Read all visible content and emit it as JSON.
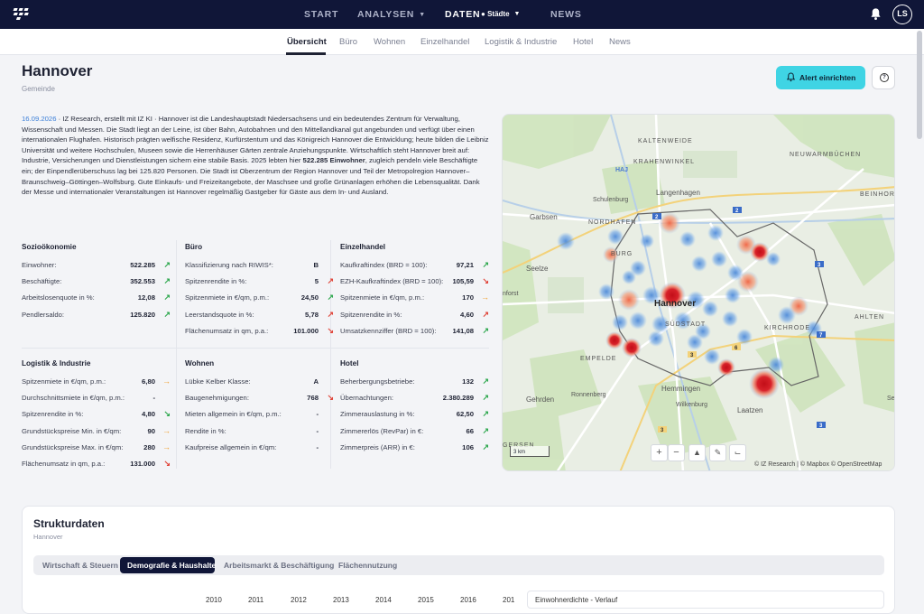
{
  "nav": {
    "items": [
      "START",
      "ANALYSEN",
      "DATEN",
      "NEWS"
    ],
    "city_selector": "Städte",
    "user_initials": "LS"
  },
  "subnav": [
    "Übersicht",
    "Büro",
    "Wohnen",
    "Einzelhandel",
    "Logistik & Industrie",
    "Hotel",
    "News"
  ],
  "header": {
    "title": "Hannover",
    "subtitle": "Gemeinde",
    "alert_button": "Alert einrichten"
  },
  "description": {
    "date": "16.09.2026",
    "source": " · IZ Research, erstellt mit IZ KI · ",
    "part1": "Hannover ist die Landeshauptstadt Niedersachsens und ein bedeutendes Zentrum für Verwaltung, Wissenschaft und Messen. Die Stadt liegt an der Leine, ist über Bahn, Autobahnen und den Mittellandkanal gut angebunden und verfügt über einen internationalen Flughafen. Historisch prägten welfische Residenz, Kurfürstentum und das Königreich Hannover die Entwicklung; heute bilden die Leibniz Universität und weitere Hochschulen, Museen sowie die Herrenhäuser Gärten zentrale Anziehungspunkte. Wirtschaftlich steht Hannover breit auf: Industrie, Versicherungen und Dienstleistungen sichern eine stabile Basis. 2025 lebten hier ",
    "highlight": "522.285 Einwohner",
    "part2": ", zugleich pendeln viele Beschäftigte ein; der Einpendlerüberschuss lag bei 125.820 Personen. Die Stadt ist Oberzentrum der Region Hannover und Teil der Metropolregion Hannover–Braunschweig–Göttingen–Wolfsburg. Gute Einkaufs- und Freizeitangebote, der Maschsee und große Grünanlagen erhöhen die Lebensqualität. Dank der Messe und internationaler Veranstaltungen ist Hannover regelmäßig Gastgeber für Gäste aus dem In- und Ausland."
  },
  "kpis": {
    "sozio": {
      "title": "Sozioökonomie",
      "rows": [
        {
          "label": "Einwohner:",
          "value": "522.285",
          "trend": "up"
        },
        {
          "label": "Beschäftigte:",
          "value": "352.553",
          "trend": "up"
        },
        {
          "label": "Arbeitslosenquote in %:",
          "value": "12,08",
          "trend": "up"
        },
        {
          "label": "Pendlersaldo:",
          "value": "125.820",
          "trend": "up"
        }
      ]
    },
    "buero": {
      "title": "Büro",
      "rows": [
        {
          "label": "Klassifizierung nach RIWIS*:",
          "value": "B",
          "trend": ""
        },
        {
          "label": "Spitzenrendite in %:",
          "value": "5",
          "trend": "up_red"
        },
        {
          "label": "Spitzenmiete in €/qm, p.m.:",
          "value": "24,50",
          "trend": "up"
        },
        {
          "label": "Leerstandsquote in %:",
          "value": "5,78",
          "trend": "up_red"
        },
        {
          "label": "Flächenumsatz in qm, p.a.:",
          "value": "101.000",
          "trend": "down"
        }
      ]
    },
    "einzel": {
      "title": "Einzelhandel",
      "rows": [
        {
          "label": "Kaufkraftindex (BRD = 100):",
          "value": "97,21",
          "trend": "up"
        },
        {
          "label": "EZH-Kaufkraftindex (BRD = 100):",
          "value": "105,59",
          "trend": "down"
        },
        {
          "label": "Spitzenmiete in €/qm, p.m.:",
          "value": "170",
          "trend": "right"
        },
        {
          "label": "Spitzenrendite in %:",
          "value": "4,60",
          "trend": "up_red"
        },
        {
          "label": "Umsatzkennziffer (BRD = 100):",
          "value": "141,08",
          "trend": "up"
        }
      ]
    },
    "logistik": {
      "title": "Logistik & Industrie",
      "rows": [
        {
          "label": "Spitzenmiete in €/qm, p.m.:",
          "value": "6,80",
          "trend": "right"
        },
        {
          "label": "Durchschnittsmiete in €/qm, p.m.:",
          "value": "-",
          "trend": ""
        },
        {
          "label": "Spitzenrendite in %:",
          "value": "4,80",
          "trend": "down_green"
        },
        {
          "label": "Grundstückspreise Min. in €/qm:",
          "value": "90",
          "trend": "right"
        },
        {
          "label": "Grundstückspreise Max. in €/qm:",
          "value": "280",
          "trend": "right"
        },
        {
          "label": "Flächenumsatz in qm, p.a.:",
          "value": "131.000",
          "trend": "down"
        }
      ]
    },
    "wohnen": {
      "title": "Wohnen",
      "rows": [
        {
          "label": "Lübke Kelber Klasse:",
          "value": "A",
          "trend": ""
        },
        {
          "label": "Baugenehmigungen:",
          "value": "768",
          "trend": "down"
        },
        {
          "label": "Mieten allgemein in €/qm, p.m.:",
          "value": "-",
          "trend": ""
        },
        {
          "label": "Rendite in %:",
          "value": "-",
          "trend": ""
        },
        {
          "label": "Kaufpreise allgemein in €/qm:",
          "value": "-",
          "trend": ""
        }
      ]
    },
    "hotel": {
      "title": "Hotel",
      "rows": [
        {
          "label": "Beherbergungsbetriebe:",
          "value": "132",
          "trend": "up"
        },
        {
          "label": "Übernachtungen:",
          "value": "2.380.289",
          "trend": "up"
        },
        {
          "label": "Zimmerauslastung in %:",
          "value": "62,50",
          "trend": "up"
        },
        {
          "label": "Zimmererlös (RevPar) in €:",
          "value": "66",
          "trend": "up"
        },
        {
          "label": "Zimmerpreis (ARR) in €:",
          "value": "106",
          "trend": "up"
        }
      ]
    }
  },
  "map": {
    "center_label": "Hannover",
    "places": [
      "KALTENWEIDE",
      "KRAHENWINKEL",
      "HAJ",
      "Schulenburg",
      "Langenhagen",
      "NEUWARMBÜCHEN",
      "Garbsen",
      "NORDHAFEN",
      "BEINHORN",
      "BURG",
      "Seelze",
      "nforst",
      "SÜDSTADT",
      "KIRCHRODE",
      "AHLTEN",
      "EMPELDE",
      "Hemmingen",
      "Wilkenburg",
      "Ronnenberg",
      "Gehrden",
      "Laatzen",
      "GERSEN",
      "Sel"
    ],
    "road_numbers": [
      "2",
      "2",
      "3",
      "6",
      "3",
      "3",
      "7",
      "3"
    ],
    "scale": "3 km",
    "attribution": "© IZ Research | © Mapbox © OpenStreetMap",
    "controls": [
      "+",
      "−"
    ]
  },
  "struktur": {
    "title": "Strukturdaten",
    "subtitle": "Hannover",
    "tabs": [
      "Wirtschaft & Steuern",
      "Demografie & Haushalte",
      "Arbeitsmarkt & Beschäftigung",
      "Flächennutzung"
    ],
    "years": [
      "2010",
      "2011",
      "2012",
      "2013",
      "2014",
      "2015",
      "2016",
      "201"
    ],
    "chart_title": "Einwohnerdichte - Verlauf"
  }
}
